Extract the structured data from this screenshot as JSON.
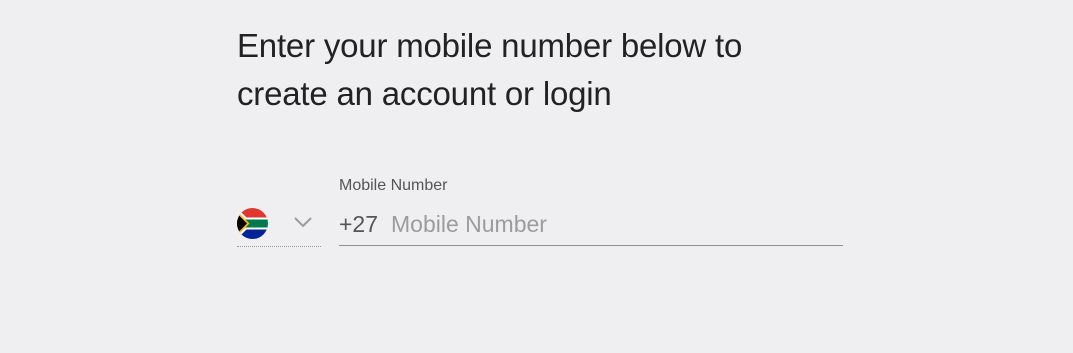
{
  "heading": {
    "line1": "Enter your mobile number below to",
    "line2": "create an account or login"
  },
  "country_selector": {
    "flag_icon": "south-africa-flag-icon",
    "chevron_icon": "chevron-down-icon"
  },
  "mobile_field": {
    "label": "Mobile Number",
    "prefix": "+27",
    "value": "",
    "placeholder": "Mobile Number"
  },
  "colors": {
    "background": "#efeff1",
    "heading_text": "#222222",
    "label_text": "#555555",
    "placeholder_text": "#9c9c9c",
    "underline": "#8f8f8f"
  }
}
